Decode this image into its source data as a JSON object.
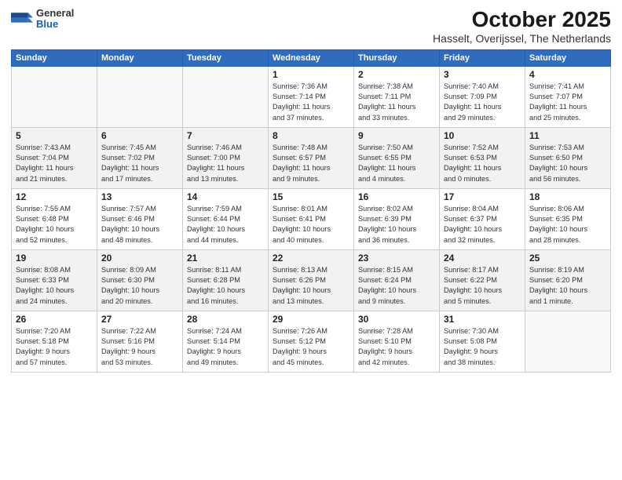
{
  "header": {
    "logo_general": "General",
    "logo_blue": "Blue",
    "title": "October 2025",
    "subtitle": "Hasselt, Overijssel, The Netherlands"
  },
  "weekdays": [
    "Sunday",
    "Monday",
    "Tuesday",
    "Wednesday",
    "Thursday",
    "Friday",
    "Saturday"
  ],
  "weeks": [
    [
      {
        "day": "",
        "info": ""
      },
      {
        "day": "",
        "info": ""
      },
      {
        "day": "",
        "info": ""
      },
      {
        "day": "1",
        "info": "Sunrise: 7:36 AM\nSunset: 7:14 PM\nDaylight: 11 hours\nand 37 minutes."
      },
      {
        "day": "2",
        "info": "Sunrise: 7:38 AM\nSunset: 7:11 PM\nDaylight: 11 hours\nand 33 minutes."
      },
      {
        "day": "3",
        "info": "Sunrise: 7:40 AM\nSunset: 7:09 PM\nDaylight: 11 hours\nand 29 minutes."
      },
      {
        "day": "4",
        "info": "Sunrise: 7:41 AM\nSunset: 7:07 PM\nDaylight: 11 hours\nand 25 minutes."
      }
    ],
    [
      {
        "day": "5",
        "info": "Sunrise: 7:43 AM\nSunset: 7:04 PM\nDaylight: 11 hours\nand 21 minutes."
      },
      {
        "day": "6",
        "info": "Sunrise: 7:45 AM\nSunset: 7:02 PM\nDaylight: 11 hours\nand 17 minutes."
      },
      {
        "day": "7",
        "info": "Sunrise: 7:46 AM\nSunset: 7:00 PM\nDaylight: 11 hours\nand 13 minutes."
      },
      {
        "day": "8",
        "info": "Sunrise: 7:48 AM\nSunset: 6:57 PM\nDaylight: 11 hours\nand 9 minutes."
      },
      {
        "day": "9",
        "info": "Sunrise: 7:50 AM\nSunset: 6:55 PM\nDaylight: 11 hours\nand 4 minutes."
      },
      {
        "day": "10",
        "info": "Sunrise: 7:52 AM\nSunset: 6:53 PM\nDaylight: 11 hours\nand 0 minutes."
      },
      {
        "day": "11",
        "info": "Sunrise: 7:53 AM\nSunset: 6:50 PM\nDaylight: 10 hours\nand 56 minutes."
      }
    ],
    [
      {
        "day": "12",
        "info": "Sunrise: 7:55 AM\nSunset: 6:48 PM\nDaylight: 10 hours\nand 52 minutes."
      },
      {
        "day": "13",
        "info": "Sunrise: 7:57 AM\nSunset: 6:46 PM\nDaylight: 10 hours\nand 48 minutes."
      },
      {
        "day": "14",
        "info": "Sunrise: 7:59 AM\nSunset: 6:44 PM\nDaylight: 10 hours\nand 44 minutes."
      },
      {
        "day": "15",
        "info": "Sunrise: 8:01 AM\nSunset: 6:41 PM\nDaylight: 10 hours\nand 40 minutes."
      },
      {
        "day": "16",
        "info": "Sunrise: 8:02 AM\nSunset: 6:39 PM\nDaylight: 10 hours\nand 36 minutes."
      },
      {
        "day": "17",
        "info": "Sunrise: 8:04 AM\nSunset: 6:37 PM\nDaylight: 10 hours\nand 32 minutes."
      },
      {
        "day": "18",
        "info": "Sunrise: 8:06 AM\nSunset: 6:35 PM\nDaylight: 10 hours\nand 28 minutes."
      }
    ],
    [
      {
        "day": "19",
        "info": "Sunrise: 8:08 AM\nSunset: 6:33 PM\nDaylight: 10 hours\nand 24 minutes."
      },
      {
        "day": "20",
        "info": "Sunrise: 8:09 AM\nSunset: 6:30 PM\nDaylight: 10 hours\nand 20 minutes."
      },
      {
        "day": "21",
        "info": "Sunrise: 8:11 AM\nSunset: 6:28 PM\nDaylight: 10 hours\nand 16 minutes."
      },
      {
        "day": "22",
        "info": "Sunrise: 8:13 AM\nSunset: 6:26 PM\nDaylight: 10 hours\nand 13 minutes."
      },
      {
        "day": "23",
        "info": "Sunrise: 8:15 AM\nSunset: 6:24 PM\nDaylight: 10 hours\nand 9 minutes."
      },
      {
        "day": "24",
        "info": "Sunrise: 8:17 AM\nSunset: 6:22 PM\nDaylight: 10 hours\nand 5 minutes."
      },
      {
        "day": "25",
        "info": "Sunrise: 8:19 AM\nSunset: 6:20 PM\nDaylight: 10 hours\nand 1 minute."
      }
    ],
    [
      {
        "day": "26",
        "info": "Sunrise: 7:20 AM\nSunset: 5:18 PM\nDaylight: 9 hours\nand 57 minutes."
      },
      {
        "day": "27",
        "info": "Sunrise: 7:22 AM\nSunset: 5:16 PM\nDaylight: 9 hours\nand 53 minutes."
      },
      {
        "day": "28",
        "info": "Sunrise: 7:24 AM\nSunset: 5:14 PM\nDaylight: 9 hours\nand 49 minutes."
      },
      {
        "day": "29",
        "info": "Sunrise: 7:26 AM\nSunset: 5:12 PM\nDaylight: 9 hours\nand 45 minutes."
      },
      {
        "day": "30",
        "info": "Sunrise: 7:28 AM\nSunset: 5:10 PM\nDaylight: 9 hours\nand 42 minutes."
      },
      {
        "day": "31",
        "info": "Sunrise: 7:30 AM\nSunset: 5:08 PM\nDaylight: 9 hours\nand 38 minutes."
      },
      {
        "day": "",
        "info": ""
      }
    ]
  ]
}
